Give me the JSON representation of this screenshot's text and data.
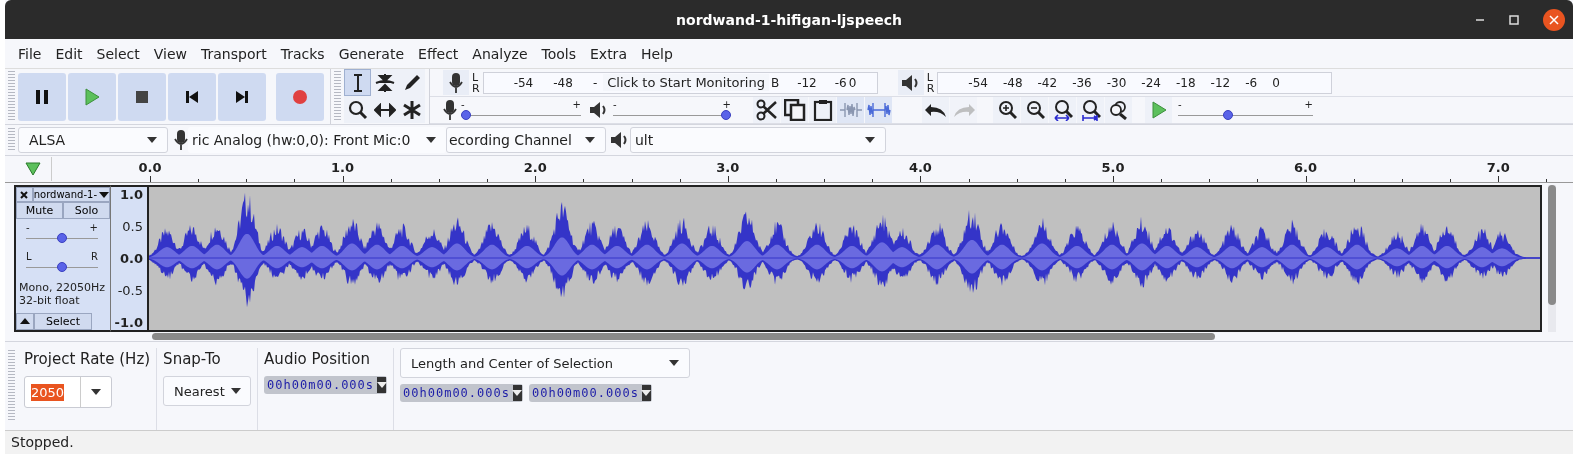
{
  "window": {
    "title": "nordwand-1-hifigan-ljspeech"
  },
  "menu": [
    "File",
    "Edit",
    "Select",
    "View",
    "Transport",
    "Tracks",
    "Generate",
    "Effect",
    "Analyze",
    "Tools",
    "Extra",
    "Help"
  ],
  "transport": [
    {
      "kind": "pause"
    },
    {
      "kind": "play"
    },
    {
      "kind": "stop"
    },
    {
      "kind": "skip-start"
    },
    {
      "kind": "skip-end"
    },
    {
      "kind": "record"
    }
  ],
  "tools": [
    {
      "kind": "select",
      "selected": true
    },
    {
      "kind": "envelope",
      "selected": false
    },
    {
      "kind": "draw",
      "selected": false
    },
    {
      "kind": "zoom",
      "selected": false
    },
    {
      "kind": "timeshift",
      "selected": false
    },
    {
      "kind": "multi",
      "selected": false
    }
  ],
  "recording_meter": {
    "channels": [
      "L",
      "R"
    ],
    "labels_before": [
      "-54",
      "-48",
      "-"
    ],
    "prompt": "Click to Start Monitoring",
    "labels_after": [
      "B",
      "-12",
      "-6",
      "0"
    ]
  },
  "playback_meter": {
    "channels": [
      "L",
      "R"
    ],
    "labels": [
      "-54",
      "-48",
      "-42",
      "-36",
      "-30",
      "-24",
      "-18",
      "-12",
      "-6",
      "0"
    ]
  },
  "recording_volume": {
    "min_label": "-",
    "max_label": "+",
    "level": 0
  },
  "playback_volume": {
    "min_label": "-",
    "max_label": "+",
    "level": 1
  },
  "edit_tools": [
    {
      "kind": "cut"
    },
    {
      "kind": "copy"
    },
    {
      "kind": "paste"
    },
    {
      "kind": "trim"
    },
    {
      "kind": "silence"
    }
  ],
  "history": [
    {
      "kind": "undo",
      "disabled": false
    },
    {
      "kind": "redo",
      "disabled": true
    }
  ],
  "zoom_tools": [
    {
      "kind": "zoom-in"
    },
    {
      "kind": "zoom-out"
    },
    {
      "kind": "fit-selection"
    },
    {
      "kind": "fit-project"
    },
    {
      "kind": "zoom-toggle"
    }
  ],
  "play_at_speed": {
    "min_label": "-",
    "max_label": "+",
    "level": 0.36
  },
  "devices": {
    "host": "ALSA",
    "recording_device": "ric Analog (hw:0,0): Front Mic:0",
    "channels": "ecording Channel",
    "playback_device": "ult"
  },
  "ruler": {
    "labels": [
      "0.0",
      "1.0",
      "2.0",
      "3.0",
      "4.0",
      "5.0",
      "6.0",
      "7.0"
    ]
  },
  "track": {
    "name": "nordwand-1-",
    "mute": "Mute",
    "solo": "Solo",
    "gain": {
      "min_label": "-",
      "max_label": "+",
      "level": 0.5
    },
    "pan": {
      "min_label": "L",
      "max_label": "R",
      "level": 0.5
    },
    "info": [
      "Mono, 22050Hz",
      "32-bit float"
    ],
    "select": "Select",
    "scale": [
      "1.0",
      "0.5",
      "0.0",
      "-0.5",
      "-1.0"
    ]
  },
  "selection_bar": {
    "rate_label": "Project Rate (Hz)",
    "rate": "2050",
    "snap_label": "Snap-To",
    "snap": "Nearest",
    "position_label": "Audio Position",
    "position": "00h00m00.000s",
    "selection_mode": "Length and Center of Selection",
    "selection_times": [
      "00h00m00.000s",
      "00h00m00.000s"
    ]
  },
  "status": "Stopped."
}
